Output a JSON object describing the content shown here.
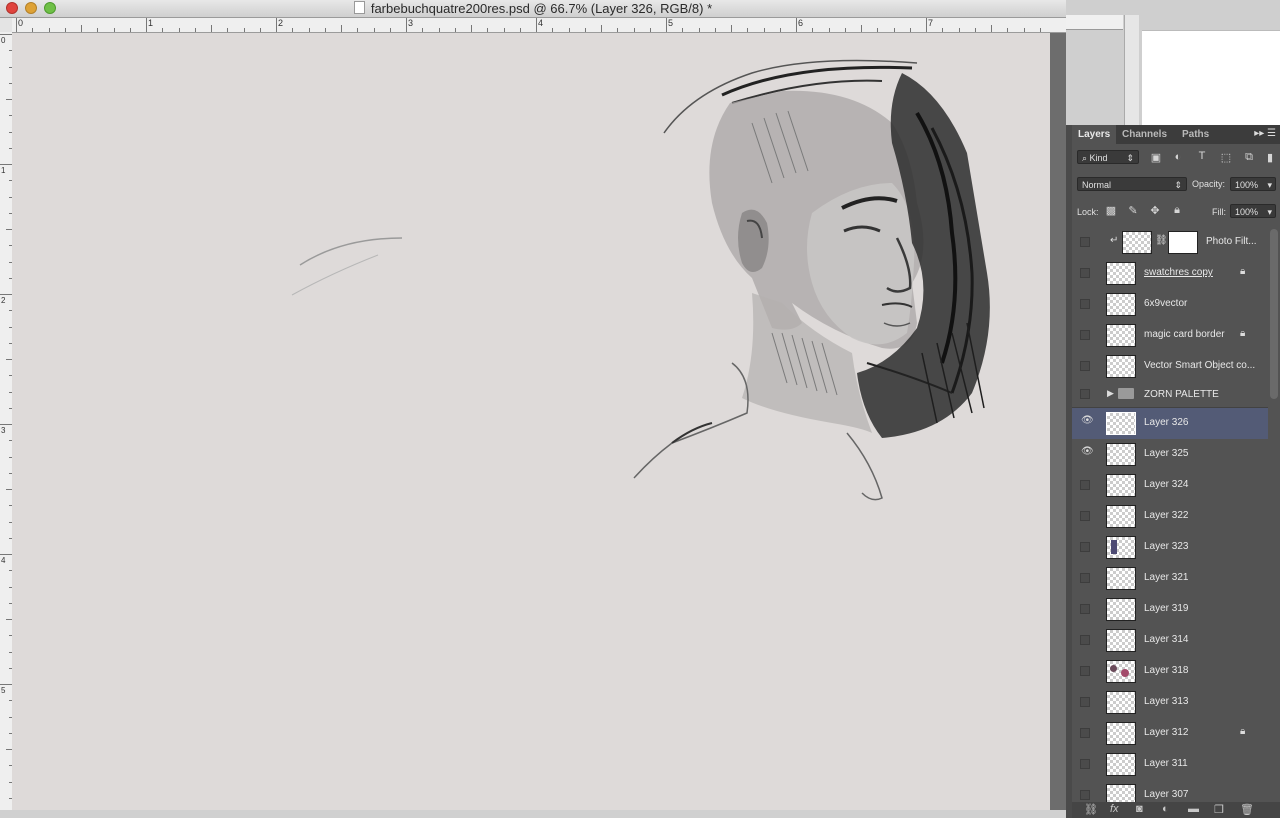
{
  "window": {
    "title": "farbebuchquatre200res.psd @ 66.7% (Layer 326, RGB/8) *"
  },
  "rulers": {
    "horizontal_labels": [
      "0",
      "1",
      "2",
      "3",
      "4",
      "5",
      "6",
      "7"
    ],
    "vertical_labels": [
      "0",
      "1",
      "2",
      "3",
      "4",
      "5"
    ]
  },
  "panel": {
    "tabs": [
      "Layers",
      "Channels",
      "Paths"
    ],
    "filter_kind": "Kind",
    "blend_mode": "Normal",
    "opacity_label": "Opacity:",
    "opacity_value": "100%",
    "lock_label": "Lock:",
    "fill_label": "Fill:",
    "fill_value": "100%",
    "layers": [
      {
        "name": "Photo Filt...",
        "visible": false,
        "locked": false,
        "adjustment": true
      },
      {
        "name": "swatchres copy",
        "visible": false,
        "locked": true
      },
      {
        "name": "6x9vector",
        "visible": false,
        "locked": false
      },
      {
        "name": "magic card border",
        "visible": false,
        "locked": true
      },
      {
        "name": "Vector Smart Object co...",
        "visible": false,
        "locked": false
      },
      {
        "name": "ZORN PALETTE",
        "visible": false,
        "locked": false,
        "group": true
      },
      {
        "name": "Layer 326",
        "visible": true,
        "locked": false,
        "selected": true
      },
      {
        "name": "Layer 325",
        "visible": true,
        "locked": false
      },
      {
        "name": "Layer 324",
        "visible": false,
        "locked": false
      },
      {
        "name": "Layer 322",
        "visible": false,
        "locked": false
      },
      {
        "name": "Layer 323",
        "visible": false,
        "locked": false
      },
      {
        "name": "Layer 321",
        "visible": false,
        "locked": false
      },
      {
        "name": "Layer 319",
        "visible": false,
        "locked": false
      },
      {
        "name": "Layer 314",
        "visible": false,
        "locked": false
      },
      {
        "name": "Layer 318",
        "visible": false,
        "locked": false
      },
      {
        "name": "Layer 313",
        "visible": false,
        "locked": false
      },
      {
        "name": "Layer 312",
        "visible": false,
        "locked": true
      },
      {
        "name": "Layer 311",
        "visible": false,
        "locked": false
      },
      {
        "name": "Layer 307",
        "visible": false,
        "locked": false
      }
    ]
  },
  "icons": {
    "eye": "eye-icon",
    "lock": "lock-icon",
    "folder": "folder-icon"
  }
}
